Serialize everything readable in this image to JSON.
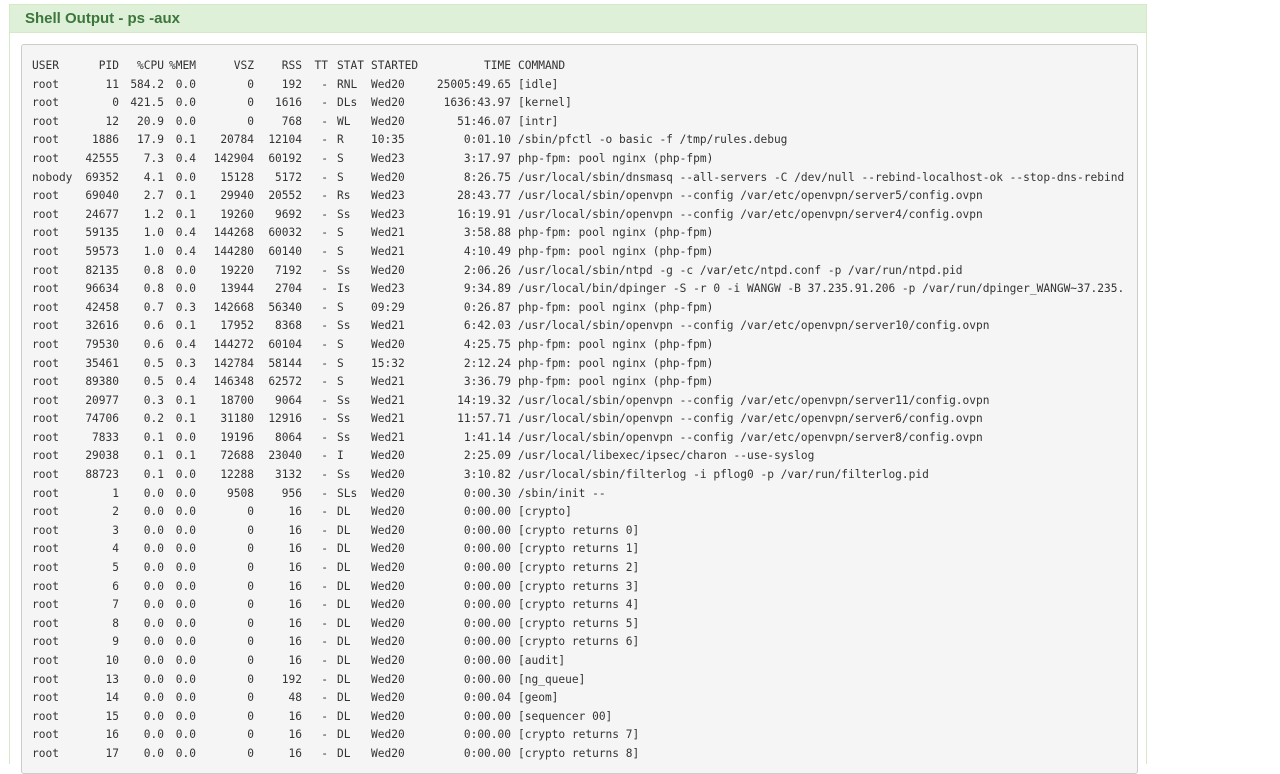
{
  "panel": {
    "title": "Shell Output - ps -aux"
  },
  "table": {
    "headers": [
      "USER",
      "PID",
      "%CPU",
      "%MEM",
      "VSZ",
      "RSS",
      "TT",
      "STAT",
      "STARTED",
      "TIME",
      "COMMAND"
    ],
    "rows": [
      [
        "root",
        "11",
        "584.2",
        "0.0",
        "0",
        "192",
        "-",
        "RNL",
        "Wed20",
        "25005:49.65",
        "[idle]"
      ],
      [
        "root",
        "0",
        "421.5",
        "0.0",
        "0",
        "1616",
        "-",
        "DLs",
        "Wed20",
        "1636:43.97",
        "[kernel]"
      ],
      [
        "root",
        "12",
        "20.9",
        "0.0",
        "0",
        "768",
        "-",
        "WL",
        "Wed20",
        "51:46.07",
        "[intr]"
      ],
      [
        "root",
        "1886",
        "17.9",
        "0.1",
        "20784",
        "12104",
        "-",
        "R",
        "10:35",
        "0:01.10",
        "/sbin/pfctl -o basic -f /tmp/rules.debug"
      ],
      [
        "root",
        "42555",
        "7.3",
        "0.4",
        "142904",
        "60192",
        "-",
        "S",
        "Wed23",
        "3:17.97",
        "php-fpm: pool nginx (php-fpm)"
      ],
      [
        "nobody",
        "69352",
        "4.1",
        "0.0",
        "15128",
        "5172",
        "-",
        "S",
        "Wed20",
        "8:26.75",
        "/usr/local/sbin/dnsmasq --all-servers -C /dev/null --rebind-localhost-ok --stop-dns-rebind"
      ],
      [
        "root",
        "69040",
        "2.7",
        "0.1",
        "29940",
        "20552",
        "-",
        "Rs",
        "Wed23",
        "28:43.77",
        "/usr/local/sbin/openvpn --config /var/etc/openvpn/server5/config.ovpn"
      ],
      [
        "root",
        "24677",
        "1.2",
        "0.1",
        "19260",
        "9692",
        "-",
        "Ss",
        "Wed23",
        "16:19.91",
        "/usr/local/sbin/openvpn --config /var/etc/openvpn/server4/config.ovpn"
      ],
      [
        "root",
        "59135",
        "1.0",
        "0.4",
        "144268",
        "60032",
        "-",
        "S",
        "Wed21",
        "3:58.88",
        "php-fpm: pool nginx (php-fpm)"
      ],
      [
        "root",
        "59573",
        "1.0",
        "0.4",
        "144280",
        "60140",
        "-",
        "S",
        "Wed21",
        "4:10.49",
        "php-fpm: pool nginx (php-fpm)"
      ],
      [
        "root",
        "82135",
        "0.8",
        "0.0",
        "19220",
        "7192",
        "-",
        "Ss",
        "Wed20",
        "2:06.26",
        "/usr/local/sbin/ntpd -g -c /var/etc/ntpd.conf -p /var/run/ntpd.pid"
      ],
      [
        "root",
        "96634",
        "0.8",
        "0.0",
        "13944",
        "2704",
        "-",
        "Is",
        "Wed23",
        "9:34.89",
        "/usr/local/bin/dpinger -S -r 0 -i WANGW -B 37.235.91.206 -p /var/run/dpinger_WANGW~37.235."
      ],
      [
        "root",
        "42458",
        "0.7",
        "0.3",
        "142668",
        "56340",
        "-",
        "S",
        "09:29",
        "0:26.87",
        "php-fpm: pool nginx (php-fpm)"
      ],
      [
        "root",
        "32616",
        "0.6",
        "0.1",
        "17952",
        "8368",
        "-",
        "Ss",
        "Wed21",
        "6:42.03",
        "/usr/local/sbin/openvpn --config /var/etc/openvpn/server10/config.ovpn"
      ],
      [
        "root",
        "79530",
        "0.6",
        "0.4",
        "144272",
        "60104",
        "-",
        "S",
        "Wed20",
        "4:25.75",
        "php-fpm: pool nginx (php-fpm)"
      ],
      [
        "root",
        "35461",
        "0.5",
        "0.3",
        "142784",
        "58144",
        "-",
        "S",
        "15:32",
        "2:12.24",
        "php-fpm: pool nginx (php-fpm)"
      ],
      [
        "root",
        "89380",
        "0.5",
        "0.4",
        "146348",
        "62572",
        "-",
        "S",
        "Wed21",
        "3:36.79",
        "php-fpm: pool nginx (php-fpm)"
      ],
      [
        "root",
        "20977",
        "0.3",
        "0.1",
        "18700",
        "9064",
        "-",
        "Ss",
        "Wed21",
        "14:19.32",
        "/usr/local/sbin/openvpn --config /var/etc/openvpn/server11/config.ovpn"
      ],
      [
        "root",
        "74706",
        "0.2",
        "0.1",
        "31180",
        "12916",
        "-",
        "Ss",
        "Wed21",
        "11:57.71",
        "/usr/local/sbin/openvpn --config /var/etc/openvpn/server6/config.ovpn"
      ],
      [
        "root",
        "7833",
        "0.1",
        "0.0",
        "19196",
        "8064",
        "-",
        "Ss",
        "Wed21",
        "1:41.14",
        "/usr/local/sbin/openvpn --config /var/etc/openvpn/server8/config.ovpn"
      ],
      [
        "root",
        "29038",
        "0.1",
        "0.1",
        "72688",
        "23040",
        "-",
        "I",
        "Wed20",
        "2:25.09",
        "/usr/local/libexec/ipsec/charon --use-syslog"
      ],
      [
        "root",
        "88723",
        "0.1",
        "0.0",
        "12288",
        "3132",
        "-",
        "Ss",
        "Wed20",
        "3:10.82",
        "/usr/local/sbin/filterlog -i pflog0 -p /var/run/filterlog.pid"
      ],
      [
        "root",
        "1",
        "0.0",
        "0.0",
        "9508",
        "956",
        "-",
        "SLs",
        "Wed20",
        "0:00.30",
        "/sbin/init --"
      ],
      [
        "root",
        "2",
        "0.0",
        "0.0",
        "0",
        "16",
        "-",
        "DL",
        "Wed20",
        "0:00.00",
        "[crypto]"
      ],
      [
        "root",
        "3",
        "0.0",
        "0.0",
        "0",
        "16",
        "-",
        "DL",
        "Wed20",
        "0:00.00",
        "[crypto returns 0]"
      ],
      [
        "root",
        "4",
        "0.0",
        "0.0",
        "0",
        "16",
        "-",
        "DL",
        "Wed20",
        "0:00.00",
        "[crypto returns 1]"
      ],
      [
        "root",
        "5",
        "0.0",
        "0.0",
        "0",
        "16",
        "-",
        "DL",
        "Wed20",
        "0:00.00",
        "[crypto returns 2]"
      ],
      [
        "root",
        "6",
        "0.0",
        "0.0",
        "0",
        "16",
        "-",
        "DL",
        "Wed20",
        "0:00.00",
        "[crypto returns 3]"
      ],
      [
        "root",
        "7",
        "0.0",
        "0.0",
        "0",
        "16",
        "-",
        "DL",
        "Wed20",
        "0:00.00",
        "[crypto returns 4]"
      ],
      [
        "root",
        "8",
        "0.0",
        "0.0",
        "0",
        "16",
        "-",
        "DL",
        "Wed20",
        "0:00.00",
        "[crypto returns 5]"
      ],
      [
        "root",
        "9",
        "0.0",
        "0.0",
        "0",
        "16",
        "-",
        "DL",
        "Wed20",
        "0:00.00",
        "[crypto returns 6]"
      ],
      [
        "root",
        "10",
        "0.0",
        "0.0",
        "0",
        "16",
        "-",
        "DL",
        "Wed20",
        "0:00.00",
        "[audit]"
      ],
      [
        "root",
        "13",
        "0.0",
        "0.0",
        "0",
        "192",
        "-",
        "DL",
        "Wed20",
        "0:00.00",
        "[ng_queue]"
      ],
      [
        "root",
        "14",
        "0.0",
        "0.0",
        "0",
        "48",
        "-",
        "DL",
        "Wed20",
        "0:00.04",
        "[geom]"
      ],
      [
        "root",
        "15",
        "0.0",
        "0.0",
        "0",
        "16",
        "-",
        "DL",
        "Wed20",
        "0:00.00",
        "[sequencer 00]"
      ],
      [
        "root",
        "16",
        "0.0",
        "0.0",
        "0",
        "16",
        "-",
        "DL",
        "Wed20",
        "0:00.00",
        "[crypto returns 7]"
      ],
      [
        "root",
        "17",
        "0.0",
        "0.0",
        "0",
        "16",
        "-",
        "DL",
        "Wed20",
        "0:00.00",
        "[crypto returns 8]"
      ]
    ]
  }
}
